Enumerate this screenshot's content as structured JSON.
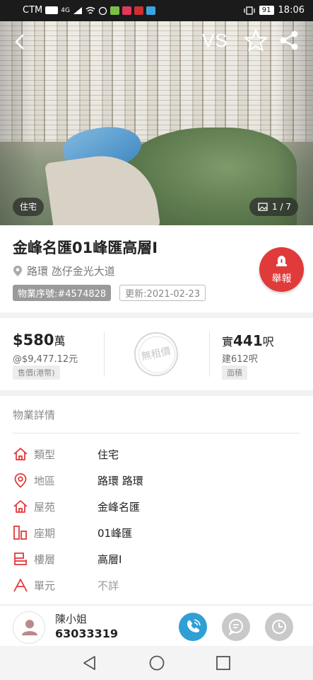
{
  "status_bar": {
    "carrier": "CTM",
    "network": "4G",
    "battery": "91",
    "time": "18:06"
  },
  "hero": {
    "vs_label": "VS",
    "property_type": "住宅",
    "photo_counter": "1 / 7"
  },
  "listing": {
    "title": "金峰名匯01峰匯高層I",
    "address": "路環 氹仔金光大道",
    "listing_id": "物業序號:#4574828",
    "updated": "更新:2021-02-23",
    "report_label": "舉報"
  },
  "price": {
    "amount": "$580",
    "unit": "萬",
    "unit_price": "@$9,477.12元",
    "label": "售價(港幣)",
    "rent_stamp": "無租價",
    "area_prefix": "實",
    "area_value": "441",
    "area_unit": "呎",
    "built_area": "建612呎",
    "area_label": "面積"
  },
  "details": {
    "section_title": "物業詳情",
    "rows": [
      {
        "key": "類型",
        "value": "住宅",
        "icon": "home-icon"
      },
      {
        "key": "地區",
        "value": "路環 路環",
        "icon": "location-pin-icon"
      },
      {
        "key": "屋苑",
        "value": "金峰名匯",
        "icon": "estate-icon"
      },
      {
        "key": "座期",
        "value": "01峰匯",
        "icon": "building-block-icon"
      },
      {
        "key": "樓層",
        "value": "高層I",
        "icon": "floor-icon"
      },
      {
        "key": "單元",
        "value": "不詳",
        "icon": "unit-icon"
      }
    ]
  },
  "agent": {
    "name": "陳小姐",
    "phone": "63033319"
  },
  "colors": {
    "accent_red": "#e03a3a",
    "call_blue": "#2f9fd6"
  }
}
